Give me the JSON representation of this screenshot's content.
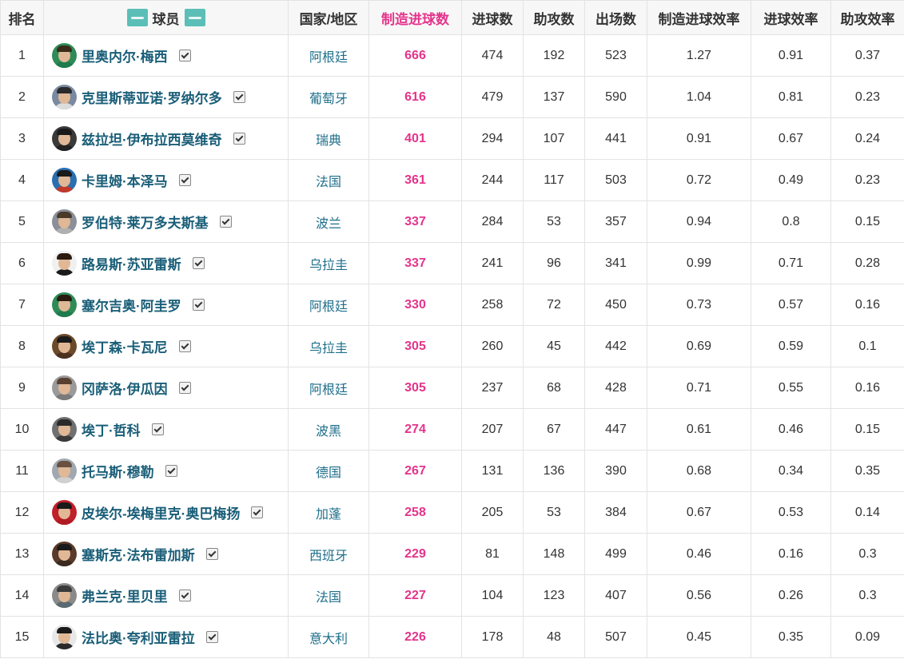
{
  "headers": {
    "rank": "排名",
    "player": "球员",
    "country": "国家/地区",
    "made": "制造进球数",
    "goals": "进球数",
    "assists": "助攻数",
    "apps": "出场数",
    "made_eff": "制造进球效率",
    "goal_eff": "进球效率",
    "assist_eff": "助攻效率"
  },
  "colors": {
    "accent": "#e4348b",
    "player_link": "#1a5e78",
    "country_link": "#1f6f8b",
    "logo": "#5bbfb7"
  },
  "rows": [
    {
      "rank": "1",
      "name": "里奥内尔·梅西",
      "country": "阿根廷",
      "made": "666",
      "goals": "474",
      "assists": "192",
      "apps": "523",
      "made_eff": "1.27",
      "goal_eff": "0.91",
      "assist_eff": "0.37",
      "avatar": {
        "bg": "#2e8b57",
        "hair": "#3a2a1a",
        "shirt": "#1f7a4d"
      }
    },
    {
      "rank": "2",
      "name": "克里斯蒂亚诺·罗纳尔多",
      "country": "葡萄牙",
      "made": "616",
      "goals": "479",
      "assists": "137",
      "apps": "590",
      "made_eff": "1.04",
      "goal_eff": "0.81",
      "assist_eff": "0.23",
      "avatar": {
        "bg": "#7a8aa0",
        "hair": "#2a2a2a",
        "shirt": "#dcdcdc"
      }
    },
    {
      "rank": "3",
      "name": "兹拉坦·伊布拉西莫维奇",
      "country": "瑞典",
      "made": "401",
      "goals": "294",
      "assists": "107",
      "apps": "441",
      "made_eff": "0.91",
      "goal_eff": "0.67",
      "assist_eff": "0.24",
      "avatar": {
        "bg": "#3a3a3a",
        "hair": "#1a1a1a",
        "shirt": "#222222"
      }
    },
    {
      "rank": "4",
      "name": "卡里姆·本泽马",
      "country": "法国",
      "made": "361",
      "goals": "244",
      "assists": "117",
      "apps": "503",
      "made_eff": "0.72",
      "goal_eff": "0.49",
      "assist_eff": "0.23",
      "avatar": {
        "bg": "#2a6fb0",
        "hair": "#1a1a1a",
        "shirt": "#c0392b"
      }
    },
    {
      "rank": "5",
      "name": "罗伯特·莱万多夫斯基",
      "country": "波兰",
      "made": "337",
      "goals": "284",
      "assists": "53",
      "apps": "357",
      "made_eff": "0.94",
      "goal_eff": "0.8",
      "assist_eff": "0.15",
      "avatar": {
        "bg": "#8a8f99",
        "hair": "#4a3a2a",
        "shirt": "#b0b0b0"
      }
    },
    {
      "rank": "6",
      "name": "路易斯·苏亚雷斯",
      "country": "乌拉圭",
      "made": "337",
      "goals": "241",
      "assists": "96",
      "apps": "341",
      "made_eff": "0.99",
      "goal_eff": "0.71",
      "assist_eff": "0.28",
      "avatar": {
        "bg": "#f0f0f0",
        "hair": "#2a1a10",
        "shirt": "#1a1a1a"
      }
    },
    {
      "rank": "7",
      "name": "塞尔吉奥·阿圭罗",
      "country": "阿根廷",
      "made": "330",
      "goals": "258",
      "assists": "72",
      "apps": "450",
      "made_eff": "0.73",
      "goal_eff": "0.57",
      "assist_eff": "0.16",
      "avatar": {
        "bg": "#2e8b57",
        "hair": "#2a1a10",
        "shirt": "#1f7a4d"
      }
    },
    {
      "rank": "8",
      "name": "埃丁森·卡瓦尼",
      "country": "乌拉圭",
      "made": "305",
      "goals": "260",
      "assists": "45",
      "apps": "442",
      "made_eff": "0.69",
      "goal_eff": "0.59",
      "assist_eff": "0.1",
      "avatar": {
        "bg": "#6b4a2a",
        "hair": "#1a1a1a",
        "shirt": "#4a3020"
      }
    },
    {
      "rank": "9",
      "name": "冈萨洛·伊瓜因",
      "country": "阿根廷",
      "made": "305",
      "goals": "237",
      "assists": "68",
      "apps": "428",
      "made_eff": "0.71",
      "goal_eff": "0.55",
      "assist_eff": "0.16",
      "avatar": {
        "bg": "#9a9a9a",
        "hair": "#5a4030",
        "shirt": "#7a7a7a"
      }
    },
    {
      "rank": "10",
      "name": "埃丁·哲科",
      "country": "波黑",
      "made": "274",
      "goals": "207",
      "assists": "67",
      "apps": "447",
      "made_eff": "0.61",
      "goal_eff": "0.46",
      "assist_eff": "0.15",
      "avatar": {
        "bg": "#707070",
        "hair": "#2a2a2a",
        "shirt": "#3a3a3a"
      }
    },
    {
      "rank": "11",
      "name": "托马斯·穆勒",
      "country": "德国",
      "made": "267",
      "goals": "131",
      "assists": "136",
      "apps": "390",
      "made_eff": "0.68",
      "goal_eff": "0.34",
      "assist_eff": "0.35",
      "avatar": {
        "bg": "#a0a8b0",
        "hair": "#6a5040",
        "shirt": "#d0d0d0"
      }
    },
    {
      "rank": "12",
      "name": "皮埃尔-埃梅里克·奥巴梅扬",
      "country": "加蓬",
      "made": "258",
      "goals": "205",
      "assists": "53",
      "apps": "384",
      "made_eff": "0.67",
      "goal_eff": "0.53",
      "assist_eff": "0.14",
      "avatar": {
        "bg": "#c0202a",
        "hair": "#1a1a1a",
        "shirt": "#b01a22"
      }
    },
    {
      "rank": "13",
      "name": "塞斯克·法布雷加斯",
      "country": "西班牙",
      "made": "229",
      "goals": "81",
      "assists": "148",
      "apps": "499",
      "made_eff": "0.46",
      "goal_eff": "0.16",
      "assist_eff": "0.3",
      "avatar": {
        "bg": "#5a3a2a",
        "hair": "#1a1a1a",
        "shirt": "#3a2a20"
      }
    },
    {
      "rank": "14",
      "name": "弗兰克·里贝里",
      "country": "法国",
      "made": "227",
      "goals": "104",
      "assists": "123",
      "apps": "407",
      "made_eff": "0.56",
      "goal_eff": "0.26",
      "assist_eff": "0.3",
      "avatar": {
        "bg": "#8a8a8a",
        "hair": "#3a3a3a",
        "shirt": "#5a6a70"
      }
    },
    {
      "rank": "15",
      "name": "法比奥·夸利亚雷拉",
      "country": "意大利",
      "made": "226",
      "goals": "178",
      "assists": "48",
      "apps": "507",
      "made_eff": "0.45",
      "goal_eff": "0.35",
      "assist_eff": "0.09",
      "avatar": {
        "bg": "#e8e8e8",
        "hair": "#1a1a1a",
        "shirt": "#2a2a2a"
      }
    }
  ]
}
